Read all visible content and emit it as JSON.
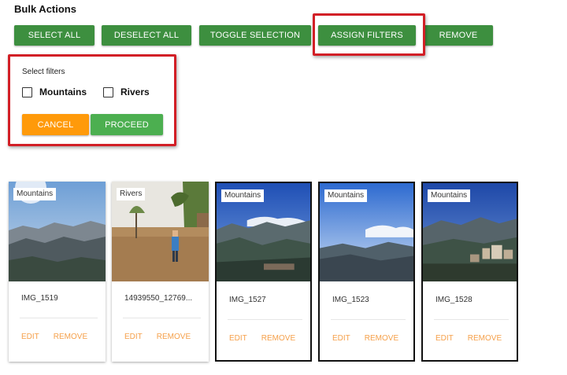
{
  "title": "Bulk Actions",
  "toolbar": {
    "select_all": "SELECT ALL",
    "deselect_all": "DESELECT ALL",
    "toggle_selection": "TOGGLE SELECTION",
    "assign_filters": "ASSIGN FILTERS",
    "remove": "REMOVE"
  },
  "filter_panel": {
    "label": "Select filters",
    "options": [
      {
        "label": "Mountains",
        "checked": false
      },
      {
        "label": "Rivers",
        "checked": false
      }
    ],
    "cancel": "CANCEL",
    "proceed": "PROCEED"
  },
  "cards": [
    {
      "tag": "Mountains",
      "name": "IMG_1519",
      "selected": false,
      "edit": "EDIT",
      "remove": "REMOVE"
    },
    {
      "tag": "Rivers",
      "name": "14939550_12769...",
      "selected": false,
      "edit": "EDIT",
      "remove": "REMOVE"
    },
    {
      "tag": "Mountains",
      "name": "IMG_1527",
      "selected": true,
      "edit": "EDIT",
      "remove": "REMOVE"
    },
    {
      "tag": "Mountains",
      "name": "IMG_1523",
      "selected": true,
      "edit": "EDIT",
      "remove": "REMOVE"
    },
    {
      "tag": "Mountains",
      "name": "IMG_1528",
      "selected": true,
      "edit": "EDIT",
      "remove": "REMOVE"
    }
  ],
  "colors": {
    "button_green": "#3d8f3f",
    "proceed_green": "#4caf50",
    "cancel_orange": "#ff9a0a",
    "highlight_red": "#d21f26",
    "action_orange": "#f5a04a"
  }
}
